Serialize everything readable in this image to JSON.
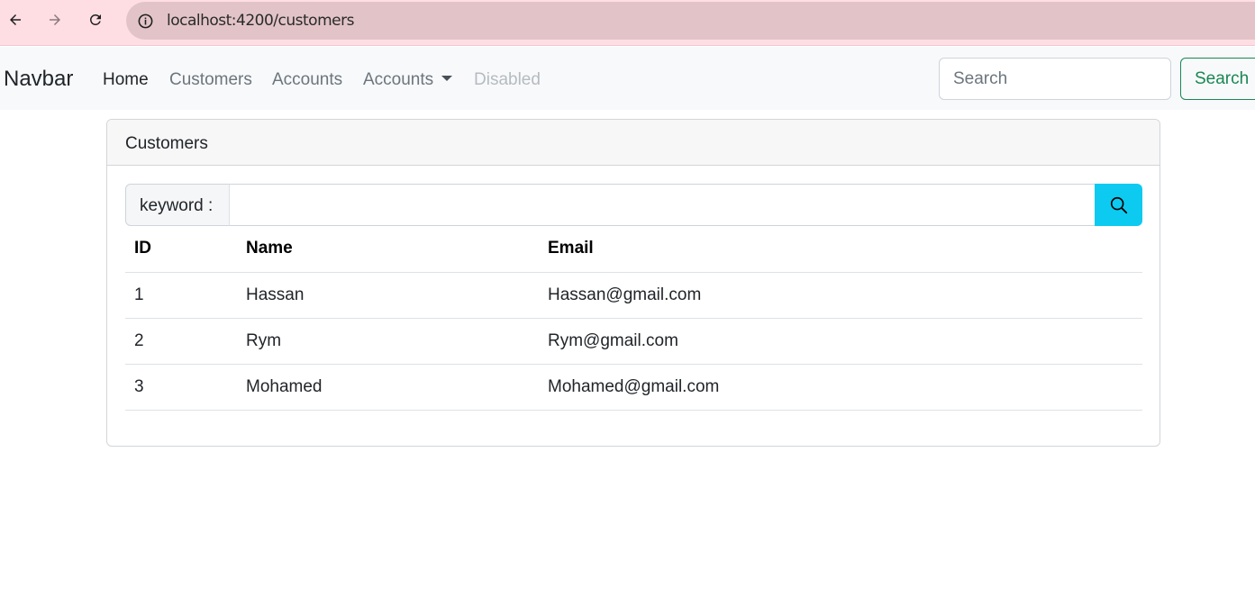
{
  "browser": {
    "url": "localhost:4200/customers"
  },
  "navbar": {
    "brand": "Navbar",
    "links": [
      {
        "label": "Home",
        "state": "active"
      },
      {
        "label": "Customers",
        "state": "normal"
      },
      {
        "label": "Accounts",
        "state": "normal"
      },
      {
        "label": "Accounts",
        "state": "dropdown"
      },
      {
        "label": "Disabled",
        "state": "disabled"
      }
    ],
    "search_placeholder": "Search",
    "search_button": "Search",
    "search_button_color": "#198754"
  },
  "card": {
    "title": "Customers",
    "keyword_label": "keyword :",
    "keyword_value": "",
    "search_button_icon": "search-icon",
    "search_button_color": "#0dcaf0"
  },
  "table": {
    "headers": [
      "ID",
      "Name",
      "Email"
    ],
    "rows": [
      [
        "1",
        "Hassan",
        "Hassan@gmail.com"
      ],
      [
        "2",
        "Rym",
        "Rym@gmail.com"
      ],
      [
        "3",
        "Mohamed",
        "Mohamed@gmail.com"
      ]
    ]
  }
}
